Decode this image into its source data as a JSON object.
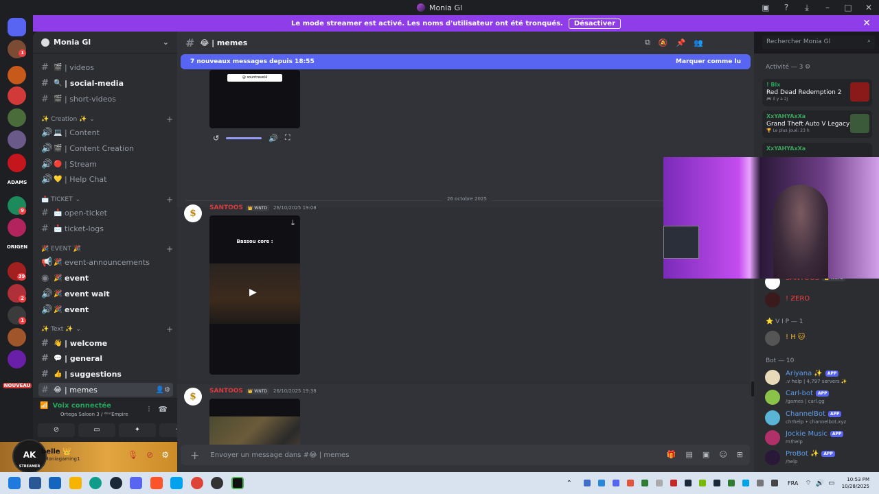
{
  "window": {
    "title": "Monia Gl"
  },
  "banner": {
    "text": "Le mode streamer est activé. Les noms d'utilisateur ont été tronqués.",
    "button": "Désactiver"
  },
  "server_badges": [
    "1",
    "9",
    "39",
    "2",
    "1"
  ],
  "server_labels": {
    "adams": "ADAMS",
    "origen": "ORIGEN",
    "nouveau": "NOUVEAU"
  },
  "guild": {
    "name": "Monia Gl"
  },
  "channels": [
    {
      "emoji": "🎬",
      "label": "| videos",
      "unread": false
    },
    {
      "emoji": "🔍",
      "label": "| social-media",
      "unread": true
    },
    {
      "emoji": "🎬",
      "label": "| short-videos",
      "unread": false
    }
  ],
  "categories": {
    "creation": "✨ Creation ✨",
    "ticket": "📩 TICKET",
    "event": "🎉 EVENT 🎉",
    "text": "✨ Text ✨"
  },
  "voice_channels": [
    {
      "emoji": "💻",
      "label": "| Content"
    },
    {
      "emoji": "🎬",
      "label": "| Content Creation"
    },
    {
      "emoji": "🔴",
      "label": "| Stream"
    },
    {
      "emoji": "💛",
      "label": "| Help Chat"
    }
  ],
  "ticket_channels": [
    {
      "emoji": "📩",
      "label": "open-ticket"
    },
    {
      "emoji": "📩",
      "label": "ticket-logs"
    }
  ],
  "event_channels": [
    {
      "emoji": "🎉",
      "label": "event-announcements",
      "unread": false
    },
    {
      "emoji": "🎉",
      "label": "event",
      "unread": true
    },
    {
      "emoji": "🎉",
      "label": "event wait",
      "unread": true
    },
    {
      "emoji": "🎉",
      "label": "event",
      "unread": true
    }
  ],
  "text_channels": [
    {
      "emoji": "👋",
      "label": "| welcome"
    },
    {
      "emoji": "💬",
      "label": "| general"
    },
    {
      "emoji": "👍",
      "label": "| suggestions"
    },
    {
      "emoji": "😂",
      "label": "| memes"
    }
  ],
  "voice_panel": {
    "title": "Voix connectée",
    "sub": "Ortega Saloon 3 / ⁰ᵇᵒʳEmpire"
  },
  "user_panel": {
    "name": "belle 👑",
    "status": ": Moniagaming1",
    "avatar_text": "AK",
    "avatar_sub": "STREAMER"
  },
  "header": {
    "channel": "😂 | memes",
    "search_placeholder": "Rechercher Monia Gl"
  },
  "new_messages": {
    "text": "7 nouveaux messages depuis 18:55",
    "mark": "Marquer comme lu"
  },
  "date_divider": "26 octobre 2025",
  "messages": [
    {
      "author": "SANTOOS",
      "tag": "👑 WNTD",
      "time": "26/10/2025 19:08",
      "caption": "Bassou core :"
    },
    {
      "author": "SANTOOS",
      "tag": "👑 WNTD",
      "time": "26/10/2025 19:38"
    }
  ],
  "video_pill": "@ sountravel4",
  "composer": {
    "placeholder": "Envoyer un message dans #😂 | memes"
  },
  "activity": {
    "title": "Activité — 3 ⚙",
    "cards": [
      {
        "user": "! Blx",
        "game": "Red Dead Redemption 2",
        "sub": "🎮 il y a 2j"
      },
      {
        "user": "XxYAHYAxXa",
        "game": "Grand Theft Auto V Legacy",
        "sub": "🏆 Le plus joué: 23 h"
      },
      {
        "user": "XxYAHYAxXa",
        "game": "",
        "sub": ""
      }
    ]
  },
  "members": {
    "santoos": {
      "name": "SANTOOS",
      "tag": "👑 WNTD"
    },
    "zero": {
      "name": "! ƵΕRO"
    },
    "vip_section": "⭐ V I P — 1",
    "vip_member": "! H 🐱",
    "bot_section": "Bot — 10",
    "bots": [
      {
        "name": "Ariyana ✨",
        "sub": ".v help | 4,797 servers ✨"
      },
      {
        "name": "Carl-bot",
        "sub": "/games | carl.gg"
      },
      {
        "name": "ChannelBot",
        "sub": "ch!help • channelbot.xyz"
      },
      {
        "name": "Jockie Music",
        "sub": "m!help"
      },
      {
        "name": "ProBot ✨",
        "sub": "/help"
      }
    ],
    "app_label": "APP"
  },
  "taskbar": {
    "time": "10:53 PM",
    "date": "10/28/2025",
    "lang": "FRA"
  }
}
